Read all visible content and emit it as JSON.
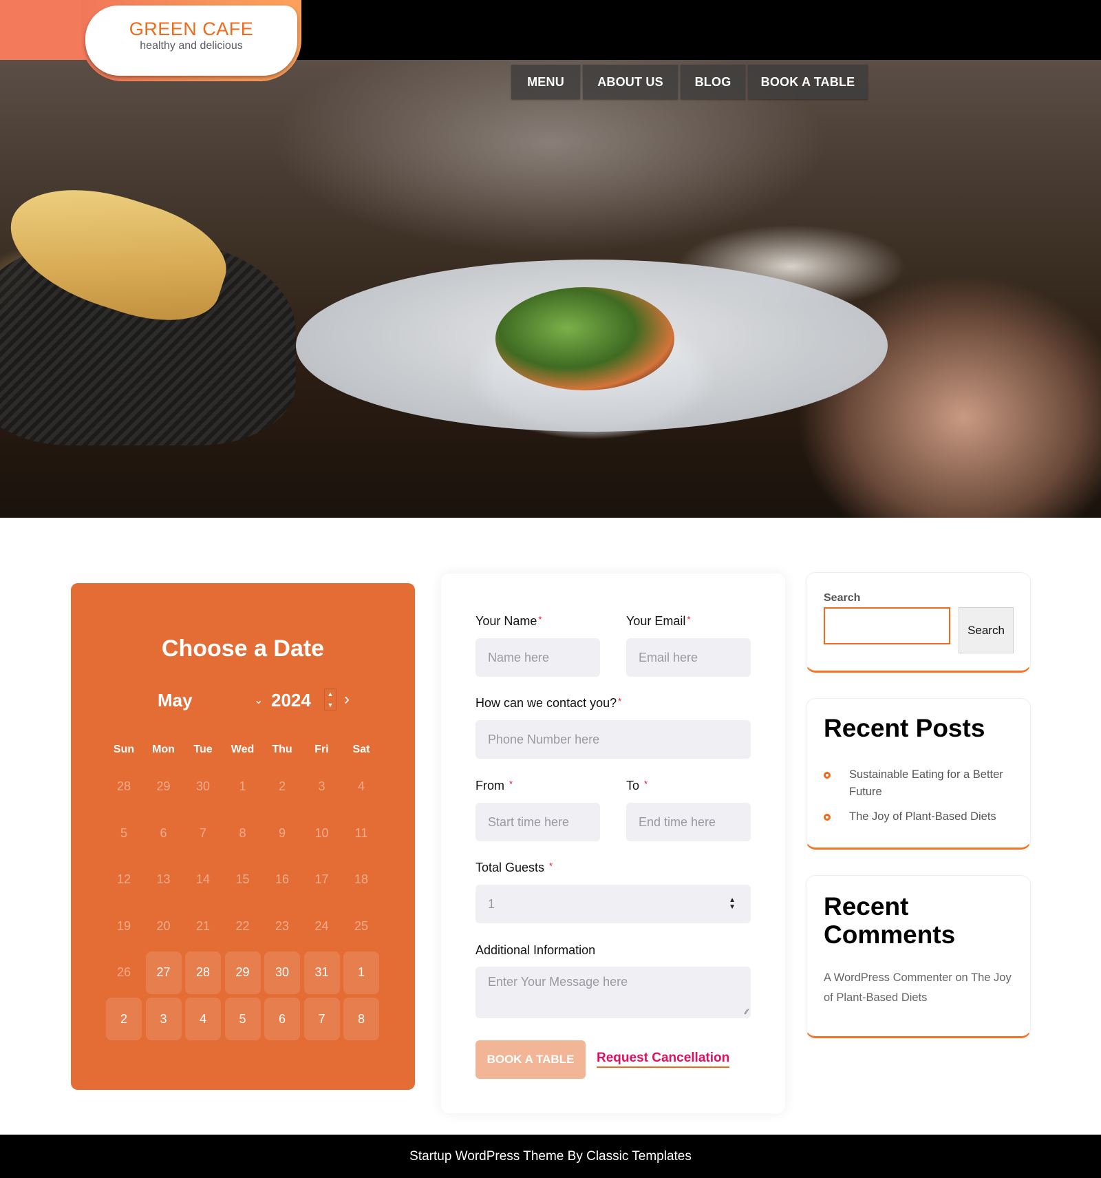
{
  "site": {
    "title": "GREEN CAFE",
    "tagline": "healthy and delicious"
  },
  "nav": {
    "items": [
      {
        "label": "MENU"
      },
      {
        "label": "ABOUT US"
      },
      {
        "label": "BLOG"
      },
      {
        "label": "BOOK A TABLE"
      }
    ]
  },
  "hero": {
    "description": "restaurant table with plated fish dish and bread basket"
  },
  "calendar": {
    "title": "Choose a Date",
    "month": "May",
    "year": "2024",
    "month_chevron": "⌄",
    "spin_up": "▲",
    "spin_down": "▼",
    "next_icon": "›",
    "weekdays": [
      "Sun",
      "Mon",
      "Tue",
      "Wed",
      "Thu",
      "Fri",
      "Sat"
    ],
    "weeks": [
      [
        {
          "d": "28",
          "s": "muted"
        },
        {
          "d": "29",
          "s": "muted"
        },
        {
          "d": "30",
          "s": "muted"
        },
        {
          "d": "1",
          "s": "muted"
        },
        {
          "d": "2",
          "s": "muted"
        },
        {
          "d": "3",
          "s": "muted"
        },
        {
          "d": "4",
          "s": "muted"
        }
      ],
      [
        {
          "d": "5",
          "s": "muted"
        },
        {
          "d": "6",
          "s": "muted"
        },
        {
          "d": "7",
          "s": "muted"
        },
        {
          "d": "8",
          "s": "muted"
        },
        {
          "d": "9",
          "s": "muted"
        },
        {
          "d": "10",
          "s": "muted"
        },
        {
          "d": "11",
          "s": "muted"
        }
      ],
      [
        {
          "d": "12",
          "s": "muted"
        },
        {
          "d": "13",
          "s": "muted"
        },
        {
          "d": "14",
          "s": "muted"
        },
        {
          "d": "15",
          "s": "muted"
        },
        {
          "d": "16",
          "s": "muted"
        },
        {
          "d": "17",
          "s": "muted"
        },
        {
          "d": "18",
          "s": "muted"
        }
      ],
      [
        {
          "d": "19",
          "s": "muted"
        },
        {
          "d": "20",
          "s": "muted"
        },
        {
          "d": "21",
          "s": "muted"
        },
        {
          "d": "22",
          "s": "muted"
        },
        {
          "d": "23",
          "s": "muted"
        },
        {
          "d": "24",
          "s": "muted"
        },
        {
          "d": "25",
          "s": "muted"
        }
      ],
      [
        {
          "d": "26",
          "s": "muted"
        },
        {
          "d": "27",
          "s": "avail"
        },
        {
          "d": "28",
          "s": "avail"
        },
        {
          "d": "29",
          "s": "avail"
        },
        {
          "d": "30",
          "s": "avail"
        },
        {
          "d": "31",
          "s": "avail"
        },
        {
          "d": "1",
          "s": "avail"
        }
      ],
      [
        {
          "d": "2",
          "s": "avail"
        },
        {
          "d": "3",
          "s": "avail"
        },
        {
          "d": "4",
          "s": "avail"
        },
        {
          "d": "5",
          "s": "avail"
        },
        {
          "d": "6",
          "s": "avail"
        },
        {
          "d": "7",
          "s": "avail"
        },
        {
          "d": "8",
          "s": "avail"
        }
      ]
    ]
  },
  "form": {
    "name_label": "Your Name",
    "name_placeholder": "Name here",
    "email_label": "Your Email",
    "email_placeholder": "Email here",
    "contact_label": "How can we contact you?",
    "phone_placeholder": "Phone Number here",
    "from_label": "From ",
    "from_placeholder": "Start time here",
    "to_label": "To ",
    "to_placeholder": "End time here",
    "guests_label": "Total Guests ",
    "guests_value": "1",
    "info_label": "Additional Information",
    "message_placeholder": "Enter Your Message here",
    "required_mark": "*",
    "book_button": "BOOK A TABLE",
    "cancel_link": "Request Cancellation"
  },
  "sidebar": {
    "search_label": "Search",
    "search_value": "",
    "search_button": "Search",
    "recent_posts_title": "Recent Posts",
    "recent_posts": [
      {
        "title": "Sustainable Eating for a Better Future"
      },
      {
        "title": "The Joy of Plant-Based Diets"
      }
    ],
    "recent_comments_title": "Recent Comments",
    "recent_comments": [
      {
        "author": "A WordPress Commenter",
        "connector": " on ",
        "post": "The Joy of Plant-Based Diets"
      }
    ]
  },
  "footer": {
    "text": "Startup WordPress Theme By Classic Templates"
  },
  "colors": {
    "accent": "#f06a1a",
    "calendar_bg": "#e46d35",
    "book_button_bg": "#f2b697",
    "cancel_link": "#e0105d",
    "required": "#e8102f"
  }
}
